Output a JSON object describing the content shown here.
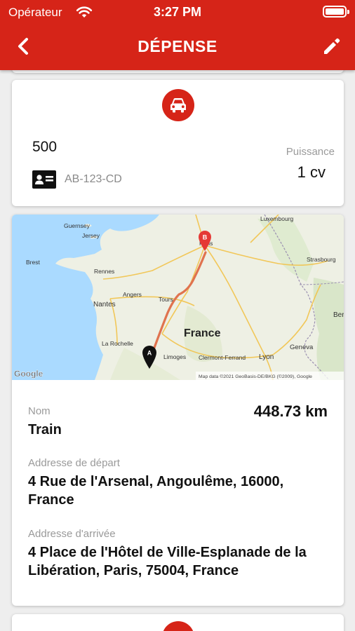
{
  "status_bar": {
    "carrier": "Opérateur",
    "time": "3:27 PM"
  },
  "header": {
    "title": "DÉPENSE",
    "back_icon": "chevron-left-icon",
    "edit_icon": "pencil-icon",
    "color": "#d62418"
  },
  "vehicle": {
    "icon": "car-icon",
    "km": "500",
    "plate": "AB-123-CD",
    "power_label": "Puissance",
    "power_value": "1 cv"
  },
  "map": {
    "labels": {
      "guernsey": "Guernsey",
      "jersey": "Jersey",
      "luxembourg": "Luxembourg",
      "brest": "Brest",
      "rennes": "Rennes",
      "paris": "Paris",
      "strasbourg": "Strasbourg",
      "nantes": "Nantes",
      "angers": "Angers",
      "tours": "Tours",
      "bern": "Bern",
      "france": "France",
      "la_rochelle": "La Rochelle",
      "geneva": "Geneva",
      "limoges": "Limoges",
      "clermont": "Clermont-Ferrand",
      "lyon": "Lyon",
      "google": "Google",
      "attribution": "Map data ©2021 GeoBasis-DE/BKG (©2009), Google"
    },
    "marker_start": "A",
    "marker_end": "B",
    "route_color": "#e0734f"
  },
  "trip": {
    "name_label": "Nom",
    "name_value": "Train",
    "distance": "448.73 km",
    "departure_label": "Addresse de départ",
    "departure_value": "4 Rue de l'Arsenal, Angoulême, 16000, France",
    "arrival_label": "Addresse d'arrivée",
    "arrival_value": "4 Place de l'Hôtel de Ville-Esplanade de la Libération, Paris, 75004, France"
  }
}
